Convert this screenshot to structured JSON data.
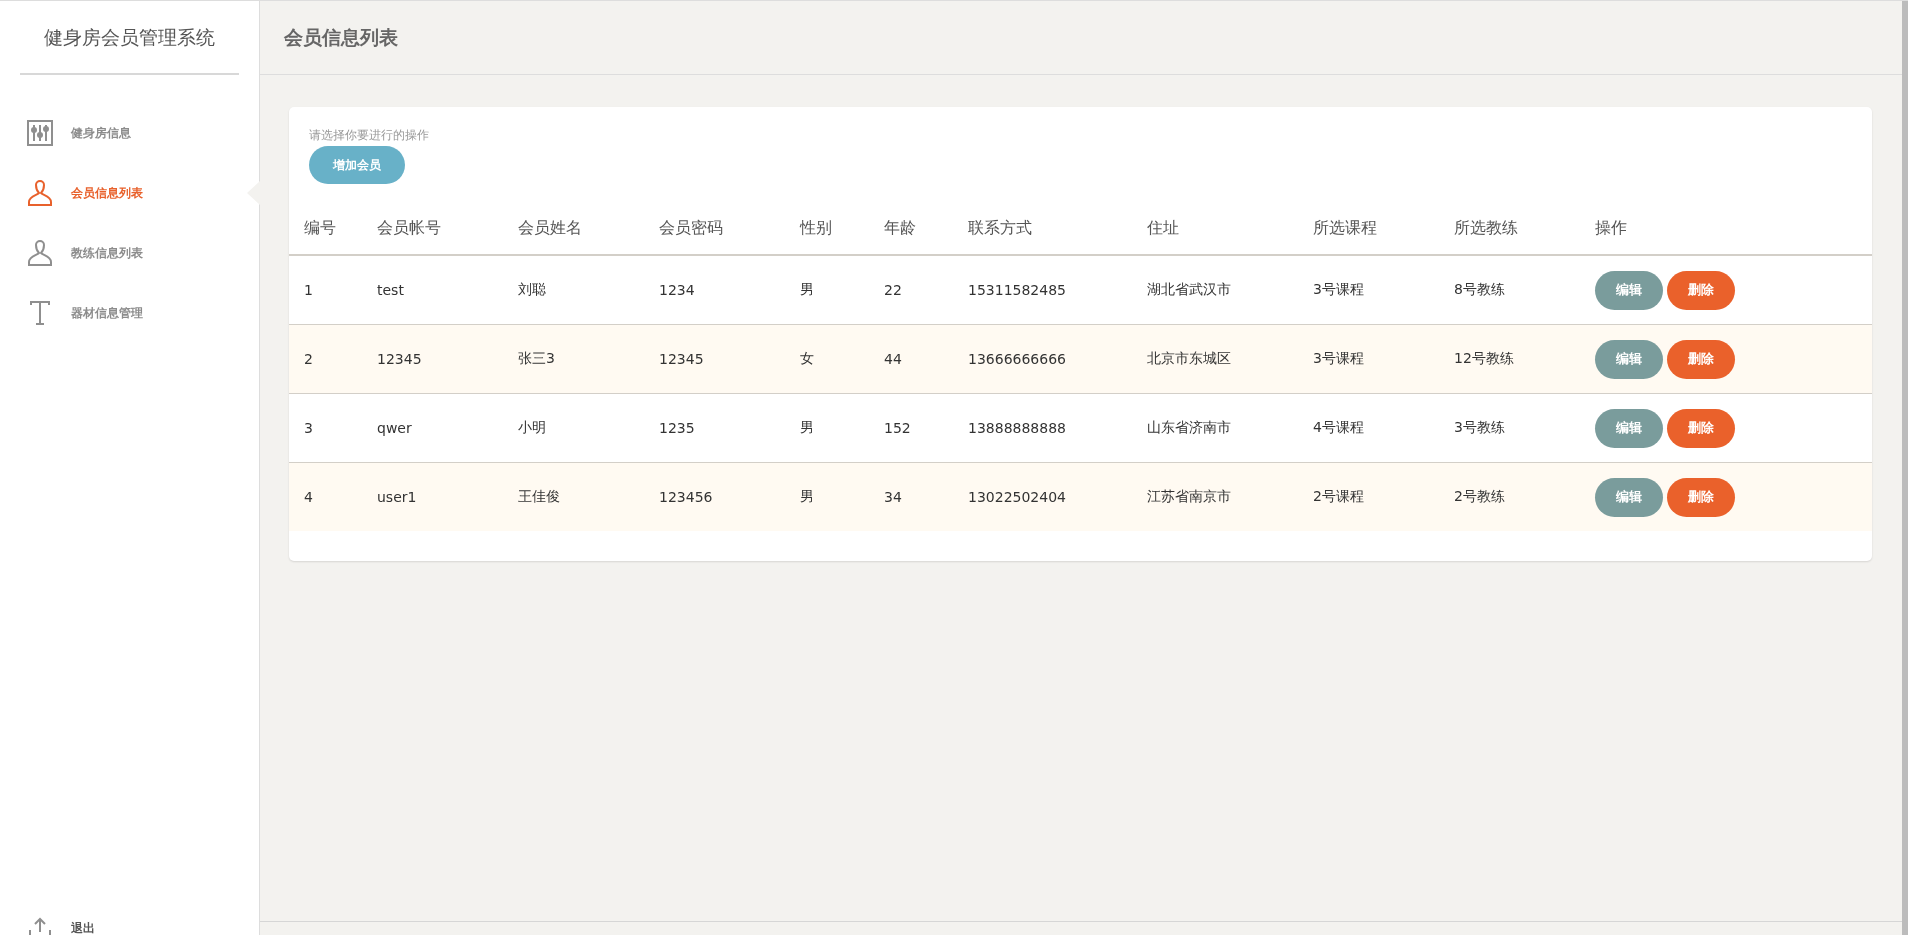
{
  "sidebar": {
    "title": "健身房会员管理系统",
    "items": [
      {
        "kind": "sliders",
        "label": "健身房信息",
        "selected": false
      },
      {
        "kind": "person",
        "label": "会员信息列表",
        "selected": true
      },
      {
        "kind": "person",
        "label": "教练信息列表",
        "selected": false
      },
      {
        "kind": "text",
        "label": "器材信息管理",
        "selected": false
      }
    ],
    "logout": {
      "label": "退出"
    }
  },
  "header": {
    "title": "会员信息列表"
  },
  "panel": {
    "hint": "请选择你要进行的操作",
    "add_button": "增加会员"
  },
  "table": {
    "columns": [
      "编号",
      "会员帐号",
      "会员姓名",
      "会员密码",
      "性别",
      "年龄",
      "联系方式",
      "住址",
      "所选课程",
      "所选教练",
      "操作"
    ],
    "rows": [
      {
        "cells": [
          "1",
          "test",
          "刘聪",
          "1234",
          "男",
          "22",
          "15311582485",
          "湖北省武汉市",
          "3号课程",
          "8号教练"
        ],
        "actions": [
          "编辑",
          "删除"
        ]
      },
      {
        "cells": [
          "2",
          "12345",
          "张三3",
          "12345",
          "女",
          "44",
          "13666666666",
          "北京市东城区",
          "3号课程",
          "12号教练"
        ],
        "actions": [
          "编辑",
          "删除"
        ]
      },
      {
        "cells": [
          "3",
          "qwer",
          "小明",
          "1235",
          "男",
          "152",
          "13888888888",
          "山东省济南市",
          "4号课程",
          "3号教练"
        ],
        "actions": [
          "编辑",
          "删除"
        ]
      },
      {
        "cells": [
          "4",
          "user1",
          "王佳俊",
          "123456",
          "男",
          "34",
          "13022502404",
          "江苏省南京市",
          "2号课程",
          "2号教练"
        ],
        "actions": [
          "编辑",
          "删除"
        ]
      }
    ]
  }
}
